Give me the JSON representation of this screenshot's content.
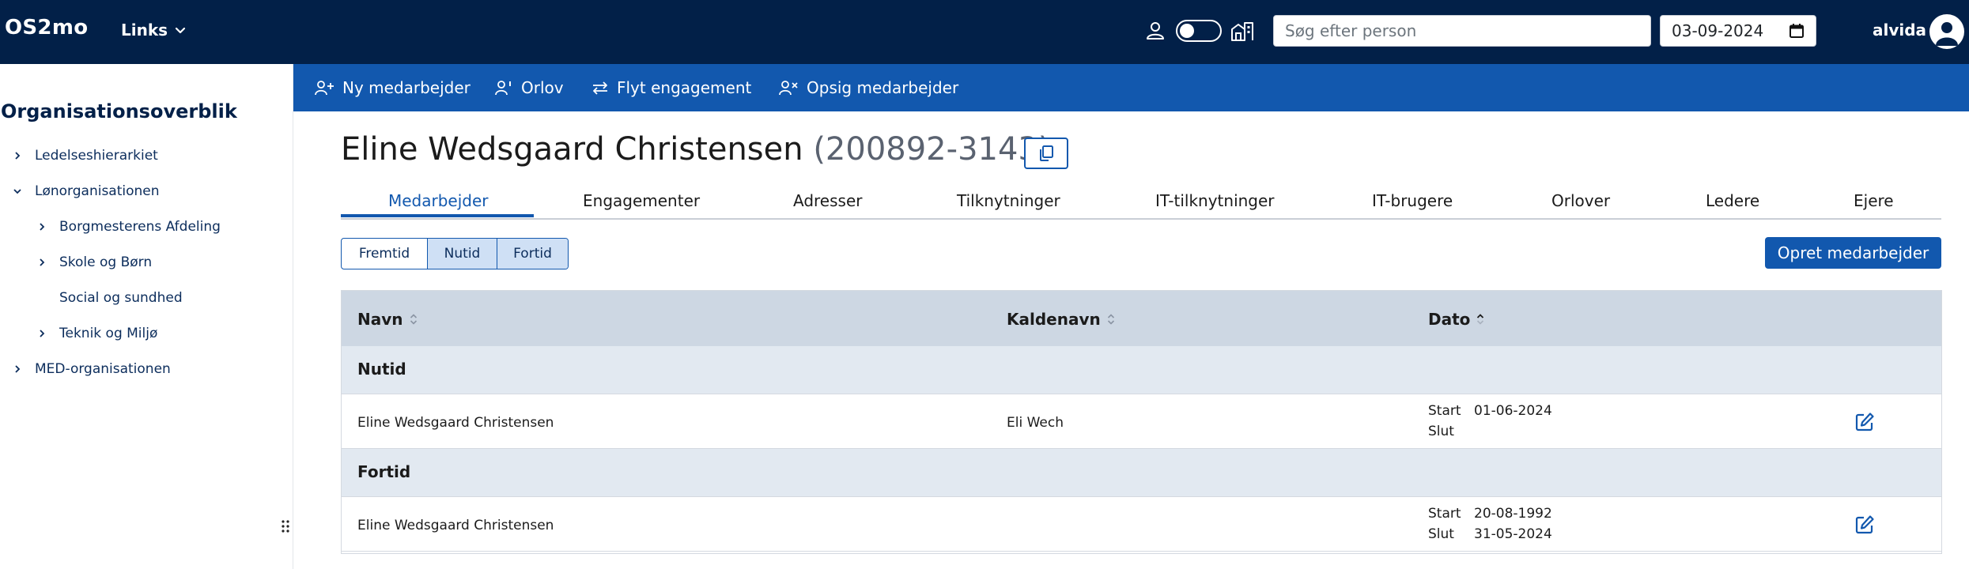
{
  "header": {
    "brand": "OS2mo",
    "links_label": "Links",
    "search_placeholder": "Søg efter person",
    "date_value": "03-09-2024",
    "username": "alvida"
  },
  "sidebar": {
    "title": "Organisationsoverblik",
    "items": [
      {
        "label": "Ledelseshierarkiet",
        "expanded": false
      },
      {
        "label": "Lønorganisationen",
        "expanded": true
      },
      {
        "label": "Borgmesterens Afdeling",
        "expanded": false
      },
      {
        "label": "Skole og Børn",
        "expanded": false
      },
      {
        "label": "Social og sundhed",
        "expanded": false
      },
      {
        "label": "Teknik og Miljø",
        "expanded": false
      },
      {
        "label": "MED-organisationen",
        "expanded": false
      }
    ]
  },
  "actions": [
    {
      "label": "Ny medarbejder",
      "icon": "person-add-icon"
    },
    {
      "label": "Orlov",
      "icon": "person-leave-icon"
    },
    {
      "label": "Flyt engagement",
      "icon": "move-icon"
    },
    {
      "label": "Opsig medarbejder",
      "icon": "person-remove-icon"
    }
  ],
  "employee": {
    "name": "Eline Wedsgaard Christensen",
    "id_text": "(200892-3143)"
  },
  "tabs": [
    {
      "label": "Medarbejder",
      "active": true
    },
    {
      "label": "Engagementer"
    },
    {
      "label": "Adresser"
    },
    {
      "label": "Tilknytninger"
    },
    {
      "label": "IT-tilknytninger"
    },
    {
      "label": "IT-brugere"
    },
    {
      "label": "Orlover"
    },
    {
      "label": "Ledere"
    },
    {
      "label": "Ejere"
    }
  ],
  "time_filter": [
    {
      "label": "Fremtid",
      "selected": false
    },
    {
      "label": "Nutid",
      "selected": true
    },
    {
      "label": "Fortid",
      "selected": true
    }
  ],
  "create_button": "Opret medarbejder",
  "table": {
    "columns": [
      "Navn",
      "Kaldenavn",
      "Dato"
    ],
    "start_label": "Start",
    "end_label": "Slut",
    "groups": [
      {
        "label": "Nutid",
        "rows": [
          {
            "name": "Eline Wedsgaard Christensen",
            "nickname": "Eli Wech",
            "start": "01-06-2024",
            "end": ""
          }
        ]
      },
      {
        "label": "Fortid",
        "rows": [
          {
            "name": "Eline Wedsgaard Christensen",
            "nickname": "",
            "start": "20-08-1992",
            "end": "31-05-2024"
          }
        ]
      }
    ]
  },
  "colors": {
    "navbar": "#022048",
    "primary": "#1258ae",
    "table_header": "#cdd7e3",
    "group_row": "#e2e9f1"
  }
}
